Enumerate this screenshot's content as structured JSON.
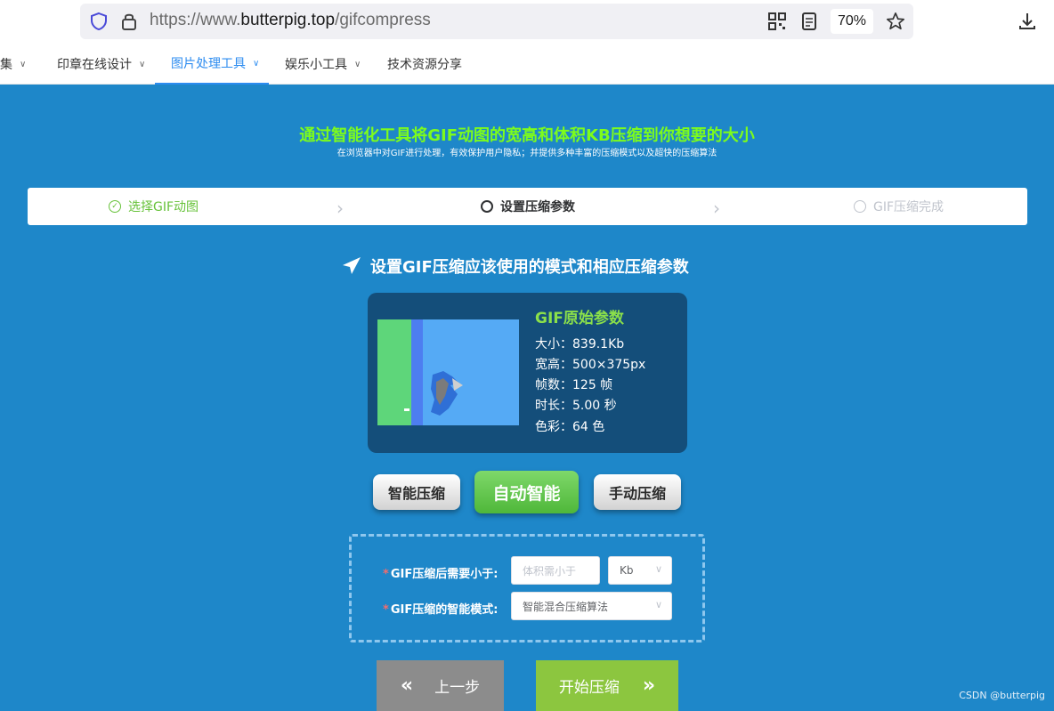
{
  "browser": {
    "url_prefix": "https://www.",
    "url_host": "butterpig.top",
    "url_path": "/gifcompress",
    "zoom": "70%",
    "icons": [
      "shield-icon",
      "lock-icon",
      "qr-code-icon",
      "reader-view-icon",
      "star-icon",
      "download-icon"
    ]
  },
  "nav": {
    "items": [
      {
        "label": "集"
      },
      {
        "label": "印章在线设计"
      },
      {
        "label": "图片处理工具"
      },
      {
        "label": "娱乐小工具"
      },
      {
        "label": "技术资源分享"
      }
    ],
    "active_index": 2
  },
  "hero": {
    "title": "通过智能化工具将GIF动图的宽高和体积KB压缩到你想要的大小",
    "subtitle": "在浏览器中对GIF进行处理，有效保护用户隐私；并提供多种丰富的压缩模式以及超快的压缩算法"
  },
  "steps": [
    {
      "label": "选择GIF动图",
      "state": "done"
    },
    {
      "label": "设置压缩参数",
      "state": "current"
    },
    {
      "label": "GIF压缩完成",
      "state": "todo"
    }
  ],
  "section": {
    "heading": "设置GIF压缩应该使用的模式和相应压缩参数"
  },
  "info_card": {
    "title": "GIF原始参数",
    "size": "大小：839.1Kb",
    "dimensions": "宽高：500×375px",
    "frames": "帧数：125 帧",
    "duration": "时长：5.00 秒",
    "colors": "色彩：64 色"
  },
  "modes": {
    "smart": "智能压缩",
    "auto": "自动智能",
    "manual": "手动压缩"
  },
  "form": {
    "size_label": "GIF压缩后需要小于:",
    "size_placeholder": "体积需小于",
    "unit_value": "Kb",
    "mode_label": "GIF压缩的智能模式:",
    "mode_value": "智能混合压缩算法",
    "required_mark": "*"
  },
  "actions": {
    "prev": "上一步",
    "start": "开始压缩"
  },
  "watermark": "CSDN @butterpig",
  "colors": {
    "page_bg": "#1e87c9",
    "hero_title": "#7dfc1c",
    "card_bg": "#144e7a",
    "card_title": "#8be04a",
    "step_done": "#67c23a",
    "start_btn": "#8cc63f",
    "prev_btn": "#8c8c8c"
  }
}
